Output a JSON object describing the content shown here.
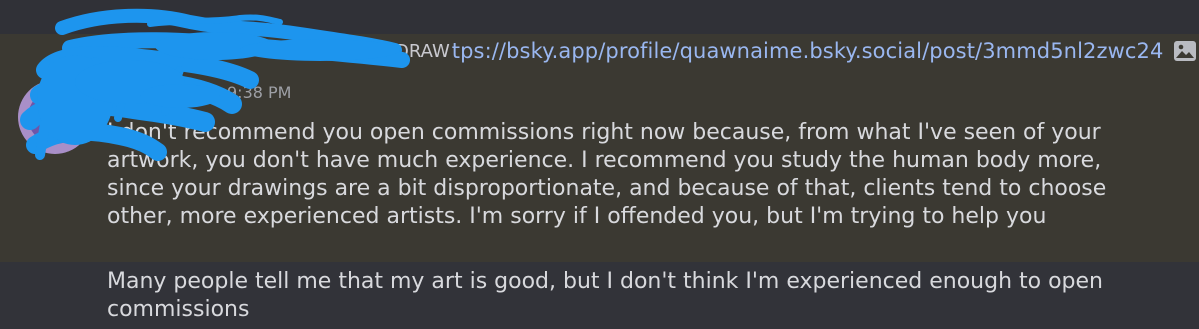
{
  "reply_preview": {
    "username_partial": "DRAW",
    "link_text": "tps://bsky.app/profile/quawnaime.bsky.social/post/3mmd5nl2zwc24",
    "icon": "image-icon"
  },
  "highlighted_message": {
    "timestamp": "9:38 PM",
    "lines": [
      "I don't recommend you open commissions right now because, from what I've seen of your",
      "artwork, you don't have much experience. I recommend you study the human body more,",
      "since your drawings are a bit disproportionate, and because of that, clients tend to choose",
      "other, more experienced artists. I'm sorry if I offended you, but I'm trying to help you"
    ]
  },
  "followup_message": {
    "lines": [
      "Many people tell me that my art is good, but I don't think I'm experienced enough to open",
      "commissions"
    ]
  },
  "colors": {
    "background": "#323339",
    "highlight": "#3b3932",
    "link": "#9ab7f0",
    "text": "#d8d9dd",
    "redaction_scribble": "#1d95ee"
  }
}
